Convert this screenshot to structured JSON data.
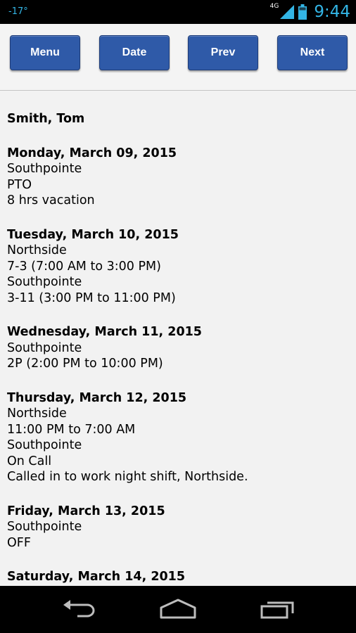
{
  "status_bar": {
    "temperature": "-17°",
    "network": "4G",
    "time": "9:44"
  },
  "toolbar": {
    "buttons": [
      {
        "label": "Menu"
      },
      {
        "label": "Date"
      },
      {
        "label": "Prev"
      },
      {
        "label": "Next"
      }
    ]
  },
  "schedule": {
    "employee": "Smith, Tom",
    "days": [
      {
        "date": "Monday, March 09, 2015",
        "lines": [
          "Southpointe",
          "PTO",
          "8 hrs vacation"
        ]
      },
      {
        "date": "Tuesday, March 10, 2015",
        "lines": [
          "Northside",
          "7-3 (7:00 AM to 3:00 PM)",
          "Southpointe",
          "3-11 (3:00 PM to 11:00 PM)"
        ]
      },
      {
        "date": "Wednesday, March 11, 2015",
        "lines": [
          "Southpointe",
          "2P (2:00 PM to 10:00 PM)"
        ]
      },
      {
        "date": "Thursday, March 12, 2015",
        "lines": [
          "Northside",
          "11:00 PM to 7:00 AM",
          "Southpointe",
          "On Call",
          "Called in to work night shift, Northside."
        ]
      },
      {
        "date": "Friday, March 13, 2015",
        "lines": [
          "Southpointe",
          "OFF"
        ]
      },
      {
        "date": "Saturday, March 14, 2015",
        "lines": []
      }
    ]
  },
  "colors": {
    "button_blue": "#2f5aa8",
    "status_accent": "#33b5e5"
  },
  "icons": {
    "nav": [
      "back-icon",
      "home-icon",
      "recent-apps-icon"
    ],
    "status": [
      "signal-icon",
      "battery-icon"
    ]
  }
}
